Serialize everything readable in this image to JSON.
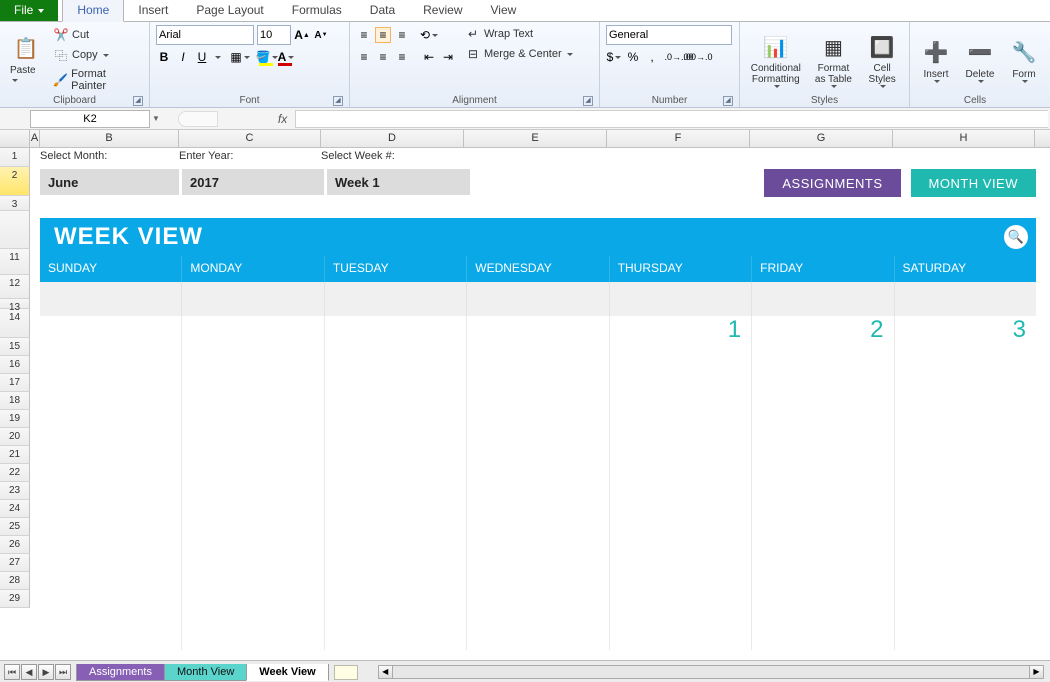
{
  "menu": {
    "file": "File",
    "tabs": [
      "Home",
      "Insert",
      "Page Layout",
      "Formulas",
      "Data",
      "Review",
      "View"
    ],
    "active": "Home"
  },
  "ribbon": {
    "clipboard": {
      "label": "Clipboard",
      "paste": "Paste",
      "cut": "Cut",
      "copy": "Copy",
      "painter": "Format Painter"
    },
    "font": {
      "label": "Font",
      "name": "Arial",
      "size": "10"
    },
    "alignment": {
      "label": "Alignment",
      "wrap": "Wrap Text",
      "merge": "Merge & Center"
    },
    "number": {
      "label": "Number",
      "format": "General"
    },
    "styles": {
      "label": "Styles",
      "cond": "Conditional Formatting",
      "table": "Format as Table",
      "cell": "Cell Styles"
    },
    "cells": {
      "label": "Cells",
      "insert": "Insert",
      "delete": "Delete",
      "format": "Form"
    }
  },
  "fx": {
    "namebox": "K2",
    "formula": ""
  },
  "cols": [
    "A",
    "B",
    "C",
    "D",
    "E",
    "F",
    "G",
    "H"
  ],
  "rows": [
    "1",
    "2",
    "3",
    "",
    "11",
    "12",
    "13",
    "14",
    "15",
    "16",
    "17",
    "18",
    "19",
    "20",
    "21",
    "22",
    "23",
    "24",
    "25",
    "26",
    "27",
    "28",
    "29"
  ],
  "sheet": {
    "labels": {
      "month": "Select Month:",
      "year": "Enter Year:",
      "week": "Select Week #:"
    },
    "inputs": {
      "month": "June",
      "year": "2017",
      "week": "Week 1"
    },
    "buttons": {
      "assignments": "ASSIGNMENTS",
      "monthview": "MONTH VIEW"
    },
    "title": "WEEK VIEW",
    "days": [
      "SUNDAY",
      "MONDAY",
      "TUESDAY",
      "WEDNESDAY",
      "THURSDAY",
      "FRIDAY",
      "SATURDAY"
    ],
    "dates": [
      "",
      "",
      "",
      "",
      "1",
      "2",
      "3"
    ]
  },
  "tabs": {
    "assignments": "Assignments",
    "month": "Month View",
    "week": "Week View"
  }
}
